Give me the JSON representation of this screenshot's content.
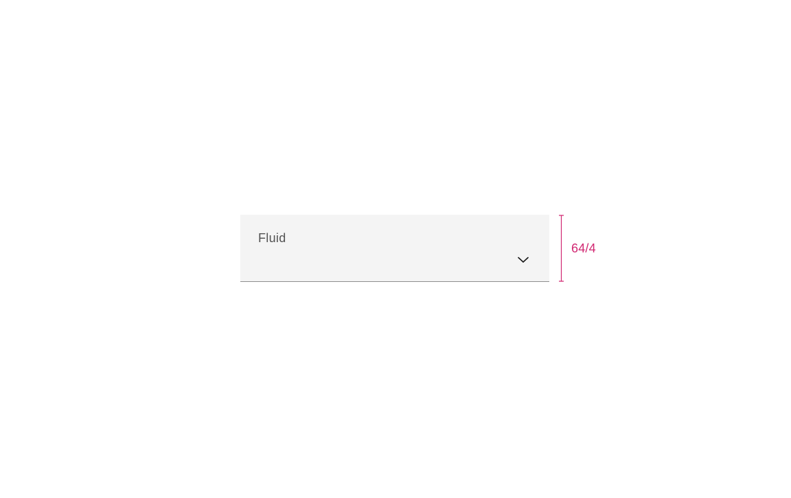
{
  "dropdown": {
    "label": "Fluid"
  },
  "measurement": {
    "value": "64/4"
  },
  "colors": {
    "accent": "#d12771",
    "field_bg": "#f4f4f4",
    "field_border": "#8d8d8d",
    "text_secondary": "#525252"
  }
}
